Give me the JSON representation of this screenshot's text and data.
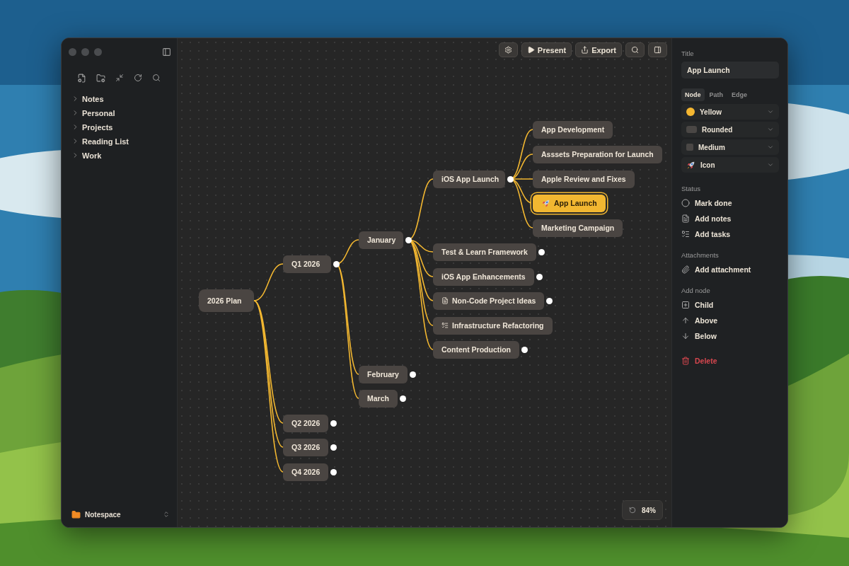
{
  "sidebar": {
    "items": [
      {
        "label": "Notes",
        "expanded": false
      },
      {
        "label": "Personal",
        "expanded": false
      },
      {
        "label": "Projects",
        "expanded": false
      },
      {
        "label": "Reading List",
        "expanded": false
      },
      {
        "label": "Work",
        "expanded": false
      }
    ],
    "workspace": "Notespace"
  },
  "toolbar": {
    "buttons": [
      {
        "kind": "settings"
      },
      {
        "kind": "present",
        "label": "Present"
      },
      {
        "kind": "export",
        "label": "Export"
      },
      {
        "kind": "search"
      },
      {
        "kind": "panel"
      }
    ]
  },
  "mindmap": {
    "zoom": "84%",
    "root": {
      "label": "2026 Plan",
      "selected": false,
      "toggle": false,
      "children": [
        {
          "label": "Q1 2026",
          "selected": false,
          "toggle": true,
          "children": [
            {
              "label": "January",
              "selected": false,
              "toggle": true,
              "children": [
                {
                  "label": "iOS App Launch",
                  "selected": false,
                  "toggle": true,
                  "children": [
                    {
                      "label": "App Development",
                      "selected": false,
                      "toggle": false
                    },
                    {
                      "label": "Asssets Preparation for Launch",
                      "selected": false,
                      "toggle": false
                    },
                    {
                      "label": "Apple Review and Fixes",
                      "selected": false,
                      "toggle": false
                    },
                    {
                      "label": "App Launch",
                      "selected": true,
                      "toggle": false,
                      "kind": "rocket"
                    },
                    {
                      "label": "Marketing Campaign",
                      "selected": false,
                      "toggle": false
                    }
                  ]
                },
                {
                  "label": "Test & Learn Framework",
                  "selected": false,
                  "toggle": true
                },
                {
                  "label": "iOS App Enhancements",
                  "selected": false,
                  "toggle": true
                },
                {
                  "label": "Non-Code Project Ideas",
                  "selected": false,
                  "toggle": true,
                  "kind": "notes"
                },
                {
                  "label": "Infrastructure Refactoring",
                  "selected": false,
                  "toggle": false,
                  "kind": "tasks"
                },
                {
                  "label": "Content Production",
                  "selected": false,
                  "toggle": true
                }
              ]
            },
            {
              "label": "February",
              "selected": false,
              "toggle": true
            },
            {
              "label": "March",
              "selected": false,
              "toggle": true
            }
          ]
        },
        {
          "label": "Q2 2026",
          "selected": false,
          "toggle": true
        },
        {
          "label": "Q3 2026",
          "selected": false,
          "toggle": true
        },
        {
          "label": "Q4 2026",
          "selected": false,
          "toggle": true
        }
      ]
    }
  },
  "inspector": {
    "title_label": "Title",
    "title_value": "App Launch",
    "tabs": [
      {
        "label": "Node",
        "selected": true
      },
      {
        "label": "Path",
        "selected": false
      },
      {
        "label": "Edge",
        "selected": false
      }
    ],
    "selects": [
      {
        "kind": "color",
        "label": "Yellow",
        "color": "#f5b731"
      },
      {
        "kind": "shape",
        "label": "Rounded"
      },
      {
        "kind": "size",
        "label": "Medium"
      },
      {
        "kind": "icon",
        "label": "Icon"
      }
    ],
    "sections": [
      {
        "heading": "Status",
        "actions": [
          {
            "label": "Mark done",
            "kind": "circle"
          },
          {
            "label": "Add notes",
            "kind": "notes"
          },
          {
            "label": "Add tasks",
            "kind": "tasks"
          }
        ]
      },
      {
        "heading": "Attachments",
        "actions": [
          {
            "label": "Add attachment",
            "kind": "paperclip"
          }
        ]
      },
      {
        "heading": "Add node",
        "actions": [
          {
            "label": "Child",
            "kind": "plus-square"
          },
          {
            "label": "Above",
            "kind": "arrow-up"
          },
          {
            "label": "Below",
            "kind": "arrow-down"
          }
        ]
      }
    ],
    "delete": {
      "label": "Delete"
    }
  }
}
